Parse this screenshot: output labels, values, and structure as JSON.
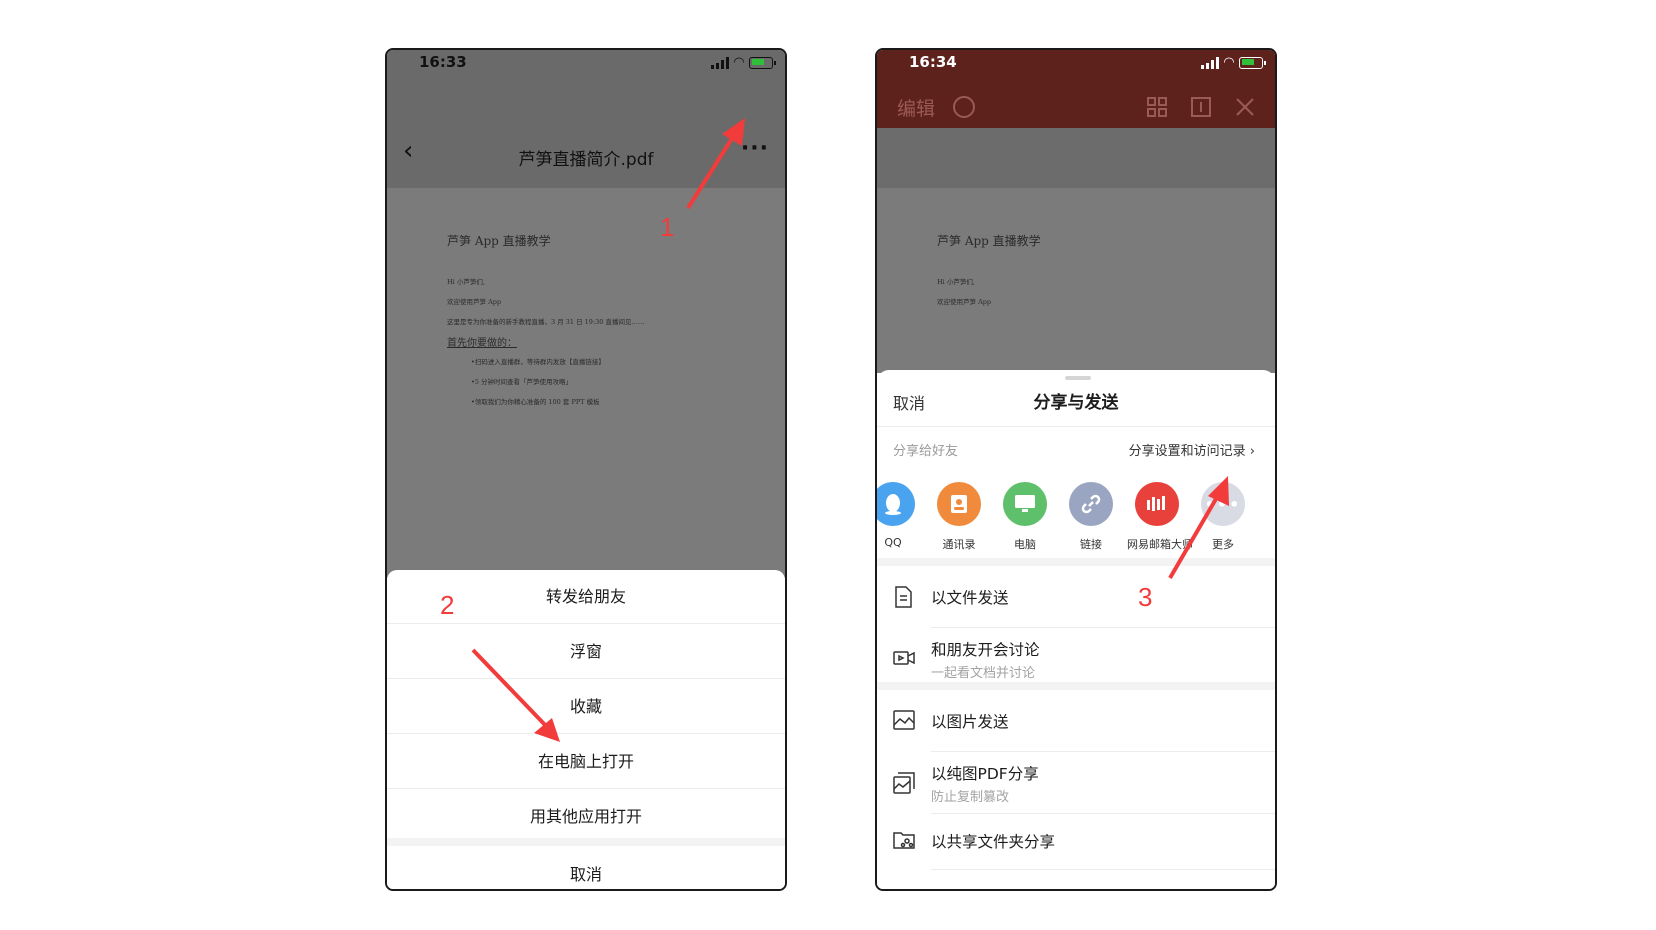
{
  "left_phone": {
    "status_time": "16:33",
    "nav_title": "芦笋直播简介.pdf",
    "doc": {
      "heading": "芦笋 App 直播教学",
      "lines": [
        "Hi 小芦笋们,",
        "欢迎使用芦笋 App",
        "这里是专为你准备的新手教程直播，3 月 31 日 19:30 直播间见……"
      ],
      "subheading": "首先你要做的：",
      "bullets": [
        "•扫码进入直播群，等待群内发放【直播链接】",
        "•5 分钟时间查看「芦笋使用攻略」",
        "•领取我们为你精心准备的 100 套 PPT 模板"
      ]
    },
    "sheet": {
      "items": [
        "转发给朋友",
        "浮窗",
        "收藏",
        "在电脑上打开",
        "用其他应用打开"
      ],
      "cancel": "取消"
    }
  },
  "right_phone": {
    "status_time": "16:34",
    "toolbar": {
      "edit": "编辑"
    },
    "doc": {
      "heading": "芦笋 App 直播教学",
      "lines": [
        "Hi 小芦笋们,",
        "欢迎使用芦笋 App"
      ]
    },
    "sheet": {
      "cancel": "取消",
      "title": "分享与发送",
      "share_label": "分享给好友",
      "share_settings": "分享设置和访问记录 ›",
      "apps": [
        {
          "label": "QQ",
          "icon": "qq-icon",
          "color": "#4aa3ef"
        },
        {
          "label": "通讯录",
          "icon": "contacts-icon",
          "color": "#f08a3d"
        },
        {
          "label": "电脑",
          "icon": "computer-icon",
          "color": "#5fc06b"
        },
        {
          "label": "链接",
          "icon": "link-icon",
          "color": "#9aa6c1"
        },
        {
          "label": "网易邮箱大师",
          "icon": "netease-mail-icon",
          "color": "#e8403a"
        },
        {
          "label": "更多",
          "icon": "more-icon",
          "color": "#d8dbe4"
        }
      ],
      "options": [
        {
          "title": "以文件发送",
          "subtitle": ""
        },
        {
          "title": "和朋友开会讨论",
          "subtitle": "一起看文档并讨论"
        },
        {
          "title": "以图片发送",
          "subtitle": ""
        },
        {
          "title": "以纯图PDF分享",
          "subtitle": "防止复制篡改"
        },
        {
          "title": "以共享文件夹分享",
          "subtitle": ""
        }
      ]
    }
  },
  "annotations": {
    "step1": "1",
    "step2": "2",
    "step3": "3",
    "color": "#f23c3c"
  }
}
